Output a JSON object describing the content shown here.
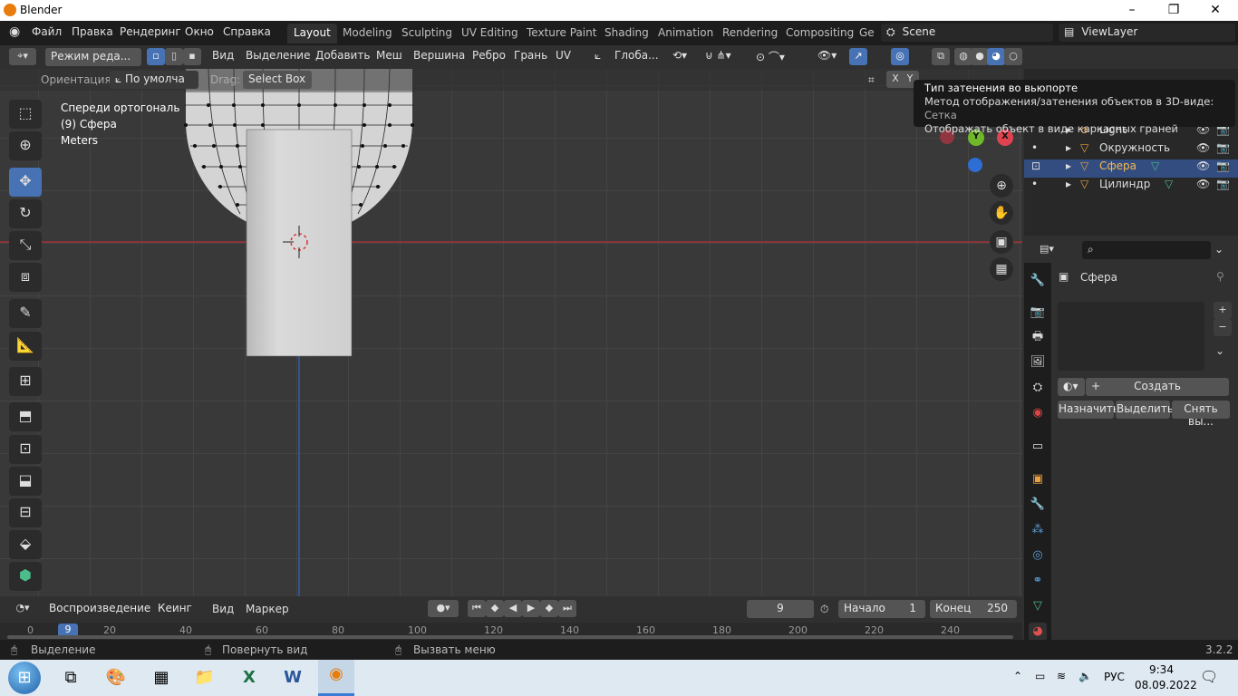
{
  "window": {
    "title": "Blender",
    "min": "–",
    "max": "❐",
    "close": "✕"
  },
  "menu": {
    "items": [
      "Файл",
      "Правка",
      "Рендеринг",
      "Окно",
      "Справка"
    ]
  },
  "workspaces": [
    "Layout",
    "Modeling",
    "Sculpting",
    "UV Editing",
    "Texture Paint",
    "Shading",
    "Animation",
    "Rendering",
    "Compositing",
    "Ge"
  ],
  "scene": {
    "label": "Scene"
  },
  "viewlayer": {
    "label": "ViewLayer"
  },
  "header3d": {
    "mode": "Режим реда...",
    "items": [
      "Вид",
      "Выделение",
      "Добавить",
      "Меш",
      "Вершина",
      "Ребро",
      "Грань",
      "UV"
    ],
    "orient": "Глоба..."
  },
  "toolopts": {
    "orient_label": "Ориентация:",
    "orient_value": "По умолча",
    "drag_label": "Drag:",
    "drag_value": "Select Box",
    "axes": [
      "X",
      "Y"
    ]
  },
  "viewport": {
    "view_name": "Спереди ортогональ",
    "object": "(9) Сфера",
    "units": "Meters"
  },
  "tooltip": {
    "line1": "Тип затенения во вьюпорте",
    "line2": "Метод отображения/затенения объектов в 3D-виде:",
    "line2_value": "Сетка",
    "line3": "Отображать объект в виде каркасных граней"
  },
  "gizmo": {
    "y": "Y",
    "x": "X"
  },
  "outliner": {
    "rows": [
      {
        "name": "Light",
        "selected": false
      },
      {
        "name": "Окружность",
        "selected": false
      },
      {
        "name": "Сфера",
        "selected": true
      },
      {
        "name": "Цилиндр",
        "selected": false
      }
    ]
  },
  "props": {
    "object_name": "Сфера",
    "create": "Создать",
    "assign": "Назначить",
    "select": "Выделить",
    "deselect": "Снять вы..."
  },
  "timeline": {
    "playback": "Воспроизведение",
    "keying": "Кеинг",
    "view": "Вид",
    "marker": "Маркер",
    "frame": "9",
    "start_label": "Начало",
    "start": "1",
    "end_label": "Конец",
    "end": "250",
    "ticks": [
      "0",
      "20",
      "40",
      "60",
      "80",
      "100",
      "120",
      "140",
      "160",
      "180",
      "200",
      "220",
      "240"
    ],
    "current": "9"
  },
  "status": {
    "select": "Выделение",
    "rotate": "Повернуть вид",
    "menu": "Вызвать меню",
    "version": "3.2.2"
  },
  "taskbar": {
    "lang": "РУС",
    "time": "9:34",
    "date": "08.09.2022"
  }
}
